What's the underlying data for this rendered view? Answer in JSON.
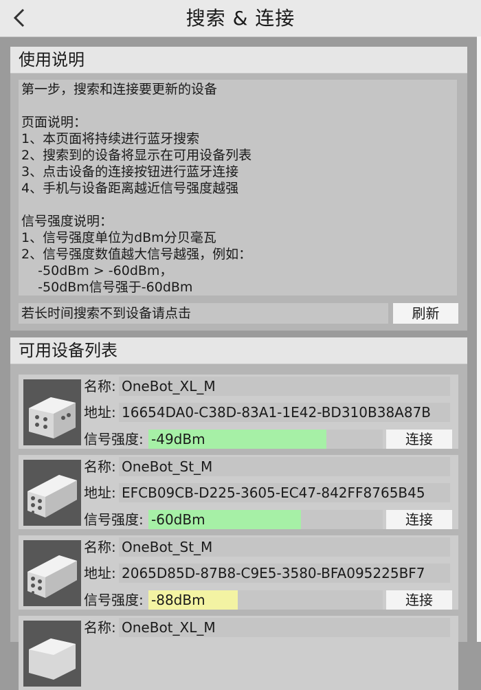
{
  "header": {
    "title": "搜索 & 连接"
  },
  "instructions": {
    "section_title": "使用说明",
    "body": "第一步，搜索和连接要更新的设备\n\n页面说明：\n1、本页面将持续进行蓝牙搜索\n2、搜索到的设备将显示在可用设备列表\n3、点击设备的连接按钮进行蓝牙连接\n4、手机与设备距离越近信号强度越强\n\n信号强度说明：\n1、信号强度单位为dBm分贝毫瓦\n2、信号强度数值越大信号越强，例如：\n    -50dBm > -60dBm，\n    -50dBm信号强于-60dBm",
    "refresh_hint": "若长时间搜索不到设备请点击",
    "refresh_label": "刷新"
  },
  "device_list": {
    "section_title": "可用设备列表",
    "name_label": "名称:",
    "address_label": "地址:",
    "signal_label": "信号强度:",
    "connect_label": "连接",
    "devices": [
      {
        "name": "OneBot_XL_M",
        "address": "16654DA0-C38D-83A1-1E42-BD310B38A87B",
        "signal": "-49dBm",
        "signal_level": 0.76,
        "signal_color": "#a6f0a6"
      },
      {
        "name": "OneBot_St_M",
        "address": "EFCB09CB-D225-3605-EC47-842FF8765B45",
        "signal": "-60dBm",
        "signal_level": 0.65,
        "signal_color": "#a6f0a6"
      },
      {
        "name": "OneBot_St_M",
        "address": "2065D85D-87B8-C9E5-3580-BFA095225BF7",
        "signal": "-88dBm",
        "signal_level": 0.38,
        "signal_color": "#f3f3a3"
      },
      {
        "name": "OneBot_XL_M"
      }
    ]
  }
}
